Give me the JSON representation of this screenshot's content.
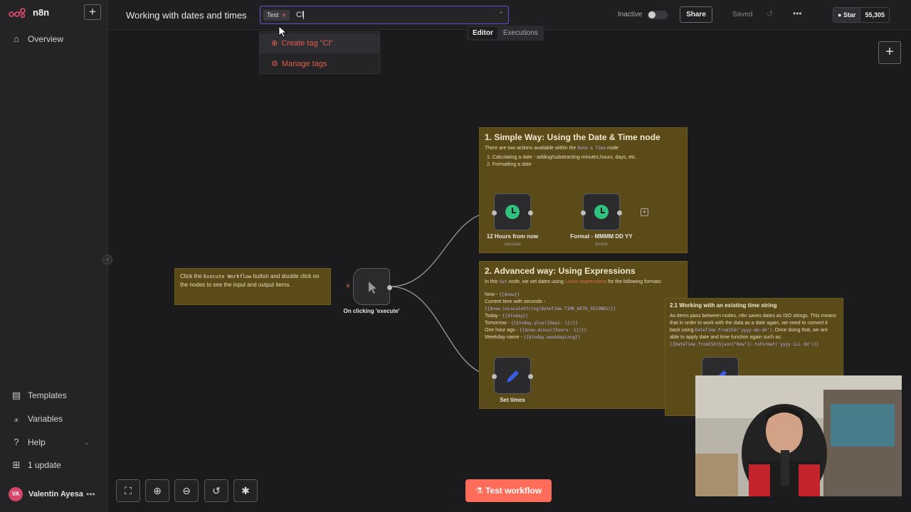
{
  "app": {
    "logo": "n8n"
  },
  "sidebar": {
    "top_item": "Overview",
    "bottom_items": [
      {
        "label": "Templates",
        "icon": "templates-icon"
      },
      {
        "label": "Variables",
        "icon": "variables-icon"
      },
      {
        "label": "Help",
        "icon": "help-icon"
      },
      {
        "label": "1 update",
        "icon": "gift-icon"
      }
    ],
    "user": {
      "initials": "VA",
      "name": "Valentin Ayesa"
    }
  },
  "header": {
    "workflow_name": "Working with dates and times",
    "tag_chip": "Test",
    "tag_typed": "Cl",
    "status_label": "Inactive",
    "share_label": "Share",
    "saved_label": "Saved",
    "github_star": "Star",
    "github_count": "55,305"
  },
  "tabs": {
    "editor": "Editor",
    "executions": "Executions"
  },
  "dropdown": {
    "create": "Create tag \"Cl\"",
    "manage": "Manage tags"
  },
  "sticky_intro": {
    "text_a": "Click the ",
    "code": "Execute Workflow",
    "text_b": " button and double click on the nodes to see the input and output items."
  },
  "sticky_simple": {
    "title": "1. Simple Way: Using the Date & Time node",
    "line1_a": "There are two actions available within the ",
    "line1_code": "Date & Time",
    "line1_b": " node:",
    "item1": "1. Calculating a date - adding/substracting minutes,hours, days, etc.",
    "item2": "2. Formatting a date"
  },
  "sticky_advanced": {
    "title": "2. Advanced way: Using Expressions",
    "intro_a": "In this ",
    "intro_code": "Set",
    "intro_b": " node, we set dates using ",
    "intro_link": "Luxon expressions",
    "intro_c": " for the following formats:",
    "rows": [
      {
        "label": "Now - ",
        "code": "{{$now}}"
      },
      {
        "label": "Current time with seconds - ",
        "code": ""
      },
      {
        "label": "",
        "code": "{{$now.toLocaleString(DateTime.TIME_WITH_SECONDS)}}"
      },
      {
        "label": "Today - ",
        "code": "{{$today}}"
      },
      {
        "label": "Tomorrow - ",
        "code": "{{$today.plus({days: 1})}}"
      },
      {
        "label": "One hour ago - ",
        "code": "{{$now.minus({hours: 1})}}"
      },
      {
        "label": "Weekday name - ",
        "code": "{{$today.weekdayLong}}"
      }
    ]
  },
  "sticky_existing": {
    "title": "2.1 Working with an existing time string",
    "line1": "As items pass between nodes, n8n saves dates as ISO strings. This means that in order to work with the data as a date again, we need to convert it back using ",
    "code1": "DateTime.fromISO('yyyy-mm-dd')",
    "line2": ". Once doing that, we are able to apply date and time function again such as: ",
    "code2": "{{DateTime.fromISO($json[\"Now\"]).toFormat('yyyy LLL dd')}}"
  },
  "nodes": {
    "trigger": {
      "label": "On clicking 'execute'"
    },
    "hours": {
      "label": "12 Hours from now",
      "sub": "calculate"
    },
    "format": {
      "label": "Format - MMMM DD YY",
      "sub": "format"
    },
    "set": {
      "label": "Set times"
    }
  },
  "controls": {
    "test_workflow": "Test workflow"
  },
  "colors": {
    "accent": "#ff6d5a",
    "sticky": "#5b4b18",
    "clock": "#2ec27e",
    "set_icon": "#3b5ce4"
  }
}
